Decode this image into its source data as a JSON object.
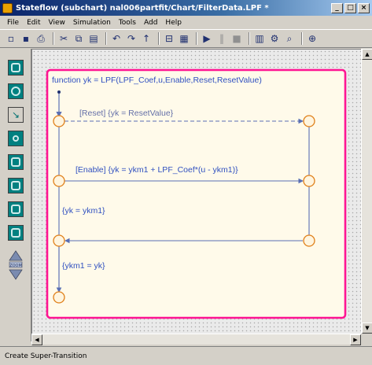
{
  "window": {
    "title": "Stateflow (subchart) nal006partfit/Chart/FilterData.LPF *",
    "buttons": {
      "minimize": "_",
      "maximize": "□",
      "close": "×"
    }
  },
  "menu": [
    "File",
    "Edit",
    "View",
    "Simulation",
    "Tools",
    "Add",
    "Help"
  ],
  "toolbar": {
    "icons": [
      "new-icon",
      "save-icon",
      "print-icon",
      "cut-icon",
      "copy-icon",
      "paste-icon",
      "undo-icon",
      "redo-icon",
      "up-icon",
      "explore-icon",
      "model-icon",
      "play-icon",
      "pause-icon",
      "stop-icon",
      "build-icon",
      "debug-icon",
      "find-icon",
      "zoom-icon"
    ]
  },
  "palette": {
    "tools": [
      "state-tool",
      "history-junction-tool",
      "default-transition-tool",
      "connective-junction-tool",
      "truth-table-tool",
      "graphical-function-tool",
      "embedded-function-tool",
      "box-tool"
    ],
    "zoom_label": "ZOOM"
  },
  "diagram": {
    "function_signature": "function yk = LPF(LPF_Coef,u,Enable,Reset,ResetValue)",
    "transitions": {
      "reset": "[Reset] {yk = ResetValue}",
      "enable": "[Enable] {yk = ykm1 + LPF_Coef*(u - ykm1)}",
      "hold": "{yk = ykm1}",
      "update": "{ykm1 = yk}"
    },
    "colors": {
      "function_border": "#ff1493",
      "function_fill": "#fffaea",
      "junction_stroke": "#e0801a",
      "junction_fill": "#fff5df",
      "transition": "#5a6fb4",
      "label": "#3050c0"
    }
  },
  "status": {
    "text": "Create Super-Transition"
  }
}
